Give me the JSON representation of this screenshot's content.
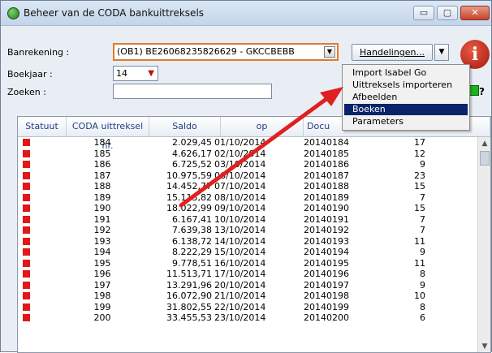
{
  "window": {
    "title": "Beheer van de CODA bankuittreksels",
    "min_label": "▭",
    "max_label": "▢",
    "close_label": "✕"
  },
  "form": {
    "account_label": "Banrekening :",
    "account_value": "(OB1) BE26068235826629 - GKCCBEBB",
    "year_label": "Boekjaar :",
    "year_value": "14",
    "search_label": "Zoeken :",
    "search_value": ""
  },
  "actions": {
    "button_label": "Handelingen...",
    "menu": [
      {
        "label": "Import Isabel Go",
        "active": false
      },
      {
        "label": "Uittreksels importeren",
        "active": false
      },
      {
        "label": "Afbeelden",
        "active": false
      },
      {
        "label": "Boeken",
        "active": true
      },
      {
        "label": "Parameters",
        "active": false
      }
    ]
  },
  "colors": {
    "highlight_border": "#e07a2a",
    "menu_selected": "#0a246a",
    "status_red": "#e21717",
    "annotation_arrow": "#e02020"
  },
  "table": {
    "headers": [
      "Statuut",
      "CODA uittreksel nr.",
      "Saldo",
      "op",
      "Docu"
    ],
    "rows": [
      {
        "nr": "184",
        "saldo": "2.029,45",
        "op": "01/10/2014",
        "doc": "20140184",
        "count": "17"
      },
      {
        "nr": "185",
        "saldo": "4.626,17",
        "op": "02/10/2014",
        "doc": "20140185",
        "count": "12"
      },
      {
        "nr": "186",
        "saldo": "6.725,52",
        "op": "03/10/2014",
        "doc": "20140186",
        "count": "9"
      },
      {
        "nr": "187",
        "saldo": "10.975,59",
        "op": "06/10/2014",
        "doc": "20140187",
        "count": "23"
      },
      {
        "nr": "188",
        "saldo": "14.452,77",
        "op": "07/10/2014",
        "doc": "20140188",
        "count": "15"
      },
      {
        "nr": "189",
        "saldo": "15.113,82",
        "op": "08/10/2014",
        "doc": "20140189",
        "count": "7"
      },
      {
        "nr": "190",
        "saldo": "18.022,99",
        "op": "09/10/2014",
        "doc": "20140190",
        "count": "15"
      },
      {
        "nr": "191",
        "saldo": "6.167,41",
        "op": "10/10/2014",
        "doc": "20140191",
        "count": "7"
      },
      {
        "nr": "192",
        "saldo": "7.639,38",
        "op": "13/10/2014",
        "doc": "20140192",
        "count": "7"
      },
      {
        "nr": "193",
        "saldo": "6.138,72",
        "op": "14/10/2014",
        "doc": "20140193",
        "count": "11"
      },
      {
        "nr": "194",
        "saldo": "8.222,29",
        "op": "15/10/2014",
        "doc": "20140194",
        "count": "9"
      },
      {
        "nr": "195",
        "saldo": "9.778,51",
        "op": "16/10/2014",
        "doc": "20140195",
        "count": "11"
      },
      {
        "nr": "196",
        "saldo": "11.513,71",
        "op": "17/10/2014",
        "doc": "20140196",
        "count": "8"
      },
      {
        "nr": "197",
        "saldo": "13.291,96",
        "op": "20/10/2014",
        "doc": "20140197",
        "count": "9"
      },
      {
        "nr": "198",
        "saldo": "16.072,90",
        "op": "21/10/2014",
        "doc": "20140198",
        "count": "10"
      },
      {
        "nr": "199",
        "saldo": "31.802,55",
        "op": "22/10/2014",
        "doc": "20140199",
        "count": "8"
      },
      {
        "nr": "200",
        "saldo": "33.455,53",
        "op": "23/10/2014",
        "doc": "20140200",
        "count": "6"
      }
    ]
  }
}
